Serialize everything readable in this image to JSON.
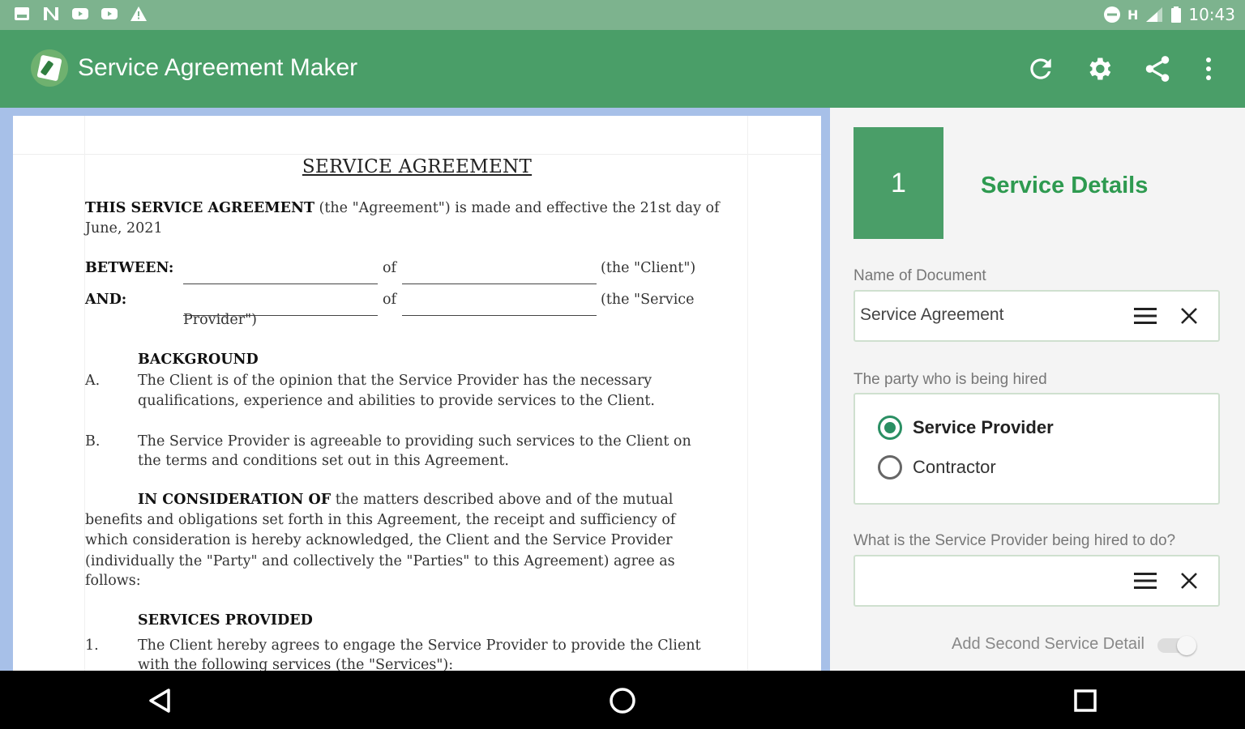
{
  "status_bar": {
    "time": "10:43",
    "network": "H",
    "icons": [
      "image-notification-icon",
      "n-notification-icon",
      "youtube-icon",
      "youtube-icon",
      "warning-icon",
      "do-not-disturb-icon",
      "signal-icon",
      "battery-icon"
    ]
  },
  "app_bar": {
    "title": "Service Agreement Maker",
    "actions": [
      "refresh-icon",
      "settings-icon",
      "share-icon",
      "overflow-menu-icon"
    ],
    "color": "#4a9e68"
  },
  "document": {
    "title": "SERVICE AGREEMENT",
    "intro_bold": "THIS SERVICE AGREEMENT",
    "intro_rest": " (the \"Agreement\") is made and effective the 21st day of",
    "intro_line2": "June, 2021",
    "between_label": "BETWEEN:",
    "of_label": "of",
    "client_tag": "(the \"Client\")",
    "and_label": "AND:",
    "provider_tag_1": "(the \"Service",
    "provider_tag_2": "Provider\")",
    "background_heading": "BACKGROUND",
    "a_marker": "A.",
    "a_line1": "The Client is of the opinion that the Service Provider has the necessary",
    "a_line2": "qualifications, experience and abilities to provide services to the Client.",
    "b_marker": "B.",
    "b_line1": "The Service Provider is agreeable to providing such services to the Client on",
    "b_line2": "the terms and conditions set out in this Agreement.",
    "consideration_bold": "IN CONSIDERATION OF",
    "consideration_rest": " the matters described above and of the mutual",
    "consideration_line2": "benefits and obligations set forth in this Agreement, the receipt and sufficiency of",
    "consideration_line3": "which consideration is hereby acknowledged, the Client and the Service Provider",
    "consideration_line4": "(individually the \"Party\" and collectively the \"Parties\" to this Agreement) agree as",
    "consideration_line5": "follows:",
    "services_heading": "SERVICES PROVIDED",
    "s1_marker": "1.",
    "s1_line1": "The Client hereby agrees to engage the Service Provider to provide the Client",
    "s1_line2": "with the following services (the \"Services\"):"
  },
  "form": {
    "step_number": "1",
    "step_title": "Service Details",
    "doc_name_label": "Name of Document",
    "doc_name_value": "Service Agreement",
    "party_label": "The party who is being hired",
    "party_options": [
      "Service Provider",
      "Contractor"
    ],
    "party_selected": "Service Provider",
    "task_label": "What is the Service Provider being hired to do?",
    "task_value": "",
    "second_detail_label": "Add Second Service Detail",
    "second_detail_enabled": false
  },
  "nav_bar": {
    "buttons": [
      "back-icon",
      "home-icon",
      "recents-icon"
    ]
  }
}
